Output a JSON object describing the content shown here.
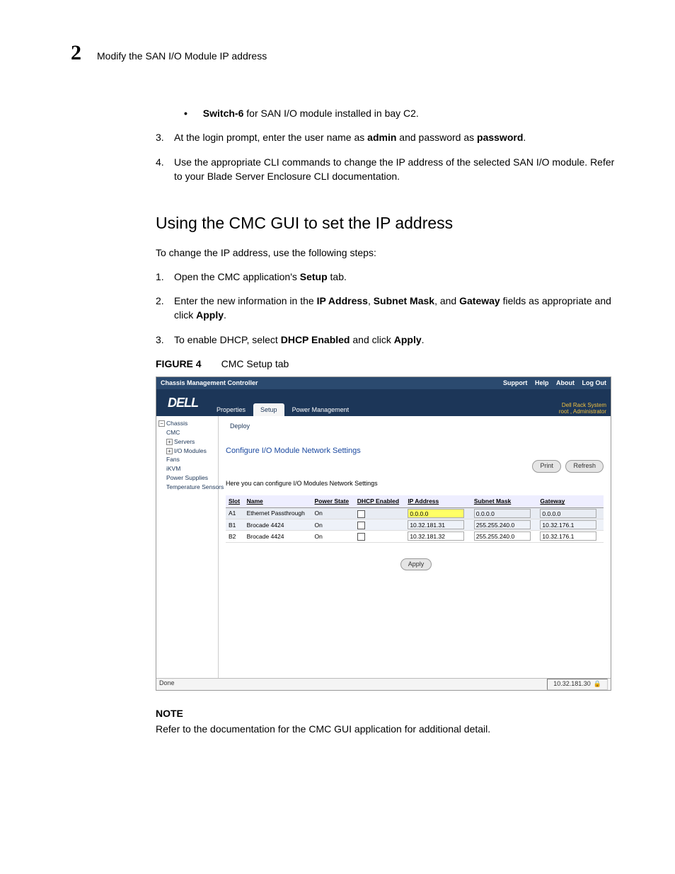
{
  "header": {
    "chapter": "2",
    "title": "Modify the SAN I/O Module IP address"
  },
  "bullet1": {
    "bold": "Switch-6",
    "rest": " for SAN I/O module installed in bay C2."
  },
  "steps_a": [
    {
      "num": "3.",
      "pre": "At the login prompt, enter the user name as ",
      "b1": "admin",
      "mid": " and password as ",
      "b2": "password",
      "post": "."
    },
    {
      "num": "4.",
      "text": "Use the appropriate CLI commands to change the IP address of the selected SAN I/O module. Refer to your Blade Server Enclosure CLI documentation."
    }
  ],
  "section_title": "Using the CMC GUI to set the IP address",
  "section_intro": "To change the IP address, use the following steps:",
  "steps_b": [
    {
      "num": "1.",
      "pre": "Open the CMC application's ",
      "b1": "Setup",
      "post": " tab."
    },
    {
      "num": "2.",
      "pre": "Enter the new information in the ",
      "b1": "IP Address",
      "mid1": ", ",
      "b2": "Subnet Mask",
      "mid2": ", and ",
      "b3": "Gateway",
      "mid3": " fields as appropriate and click ",
      "b4": "Apply",
      "post": "."
    },
    {
      "num": "3.",
      "pre": "To enable DHCP, select ",
      "b1": "DHCP Enabled",
      "mid1": " and click ",
      "b2": "Apply",
      "post": "."
    }
  ],
  "figure": {
    "label": "FIGURE 4",
    "caption": "CMC Setup tab"
  },
  "screenshot": {
    "topbar_title": "Chassis Management Controller",
    "toplinks": [
      "Support",
      "Help",
      "About",
      "Log Out"
    ],
    "userinfo1": "Dell Rack System",
    "userinfo2": "root , Administrator",
    "logo": "DELL",
    "tabs": [
      "Properties",
      "Setup",
      "Power Management"
    ],
    "subtab": "Deploy",
    "tree": [
      "Chassis",
      "CMC",
      "Servers",
      "I/O Modules",
      "Fans",
      "iKVM",
      "Power Supplies",
      "Temperature Sensors"
    ],
    "page_title": "Configure I/O Module Network Settings",
    "btn_print": "Print",
    "btn_refresh": "Refresh",
    "desc": "Here you can configure I/O Modules Network Settings",
    "table": {
      "headers": [
        "Slot",
        "Name",
        "Power State",
        "DHCP Enabled",
        "IP Address",
        "Subnet Mask",
        "Gateway"
      ],
      "rows": [
        {
          "slot": "A1",
          "name": "Ethernet Passthrough",
          "power": "On",
          "ip": "0.0.0.0",
          "mask": "0.0.0.0",
          "gw": "0.0.0.0",
          "hl": true
        },
        {
          "slot": "B1",
          "name": "Brocade 4424",
          "power": "On",
          "ip": "10.32.181.31",
          "mask": "255.255.240.0",
          "gw": "10.32.176.1",
          "hl": false
        },
        {
          "slot": "B2",
          "name": "Brocade 4424",
          "power": "On",
          "ip": "10.32.181.32",
          "mask": "255.255.240.0",
          "gw": "10.32.176.1",
          "hl": false
        }
      ]
    },
    "btn_apply": "Apply",
    "status_left": "Done",
    "status_right": "10.32.181.30"
  },
  "note": {
    "label": "NOTE",
    "text": "Refer to the documentation for the CMC GUI application for additional detail."
  }
}
